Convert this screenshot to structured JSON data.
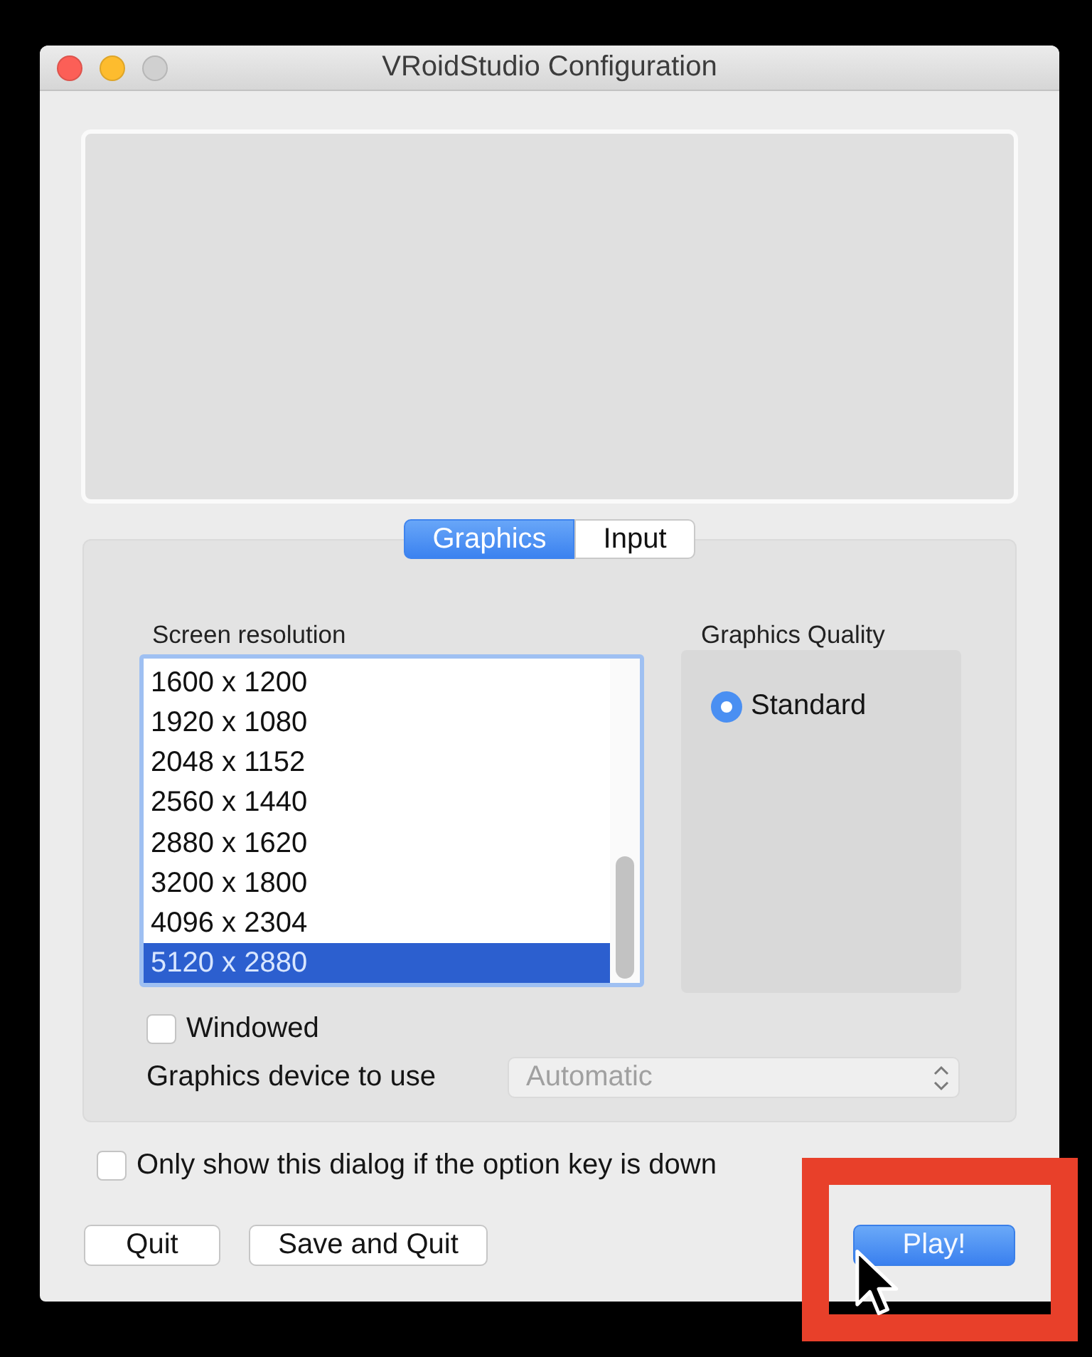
{
  "window": {
    "title": "VRoidStudio Configuration",
    "controls": [
      {
        "kind": "close",
        "disabled": false
      },
      {
        "kind": "minimize",
        "disabled": false
      },
      {
        "kind": "zoom",
        "disabled": true
      }
    ]
  },
  "tabs": [
    {
      "label": "Graphics",
      "selected": true
    },
    {
      "label": "Input",
      "selected": false
    }
  ],
  "screen_resolution": {
    "label": "Screen resolution",
    "items": [
      {
        "label": "1600 x 1200",
        "selected": false
      },
      {
        "label": "1920 x 1080",
        "selected": false
      },
      {
        "label": "2048 x 1152",
        "selected": false
      },
      {
        "label": "2560 x 1440",
        "selected": false
      },
      {
        "label": "2880 x 1620",
        "selected": false
      },
      {
        "label": "3200 x 1800",
        "selected": false
      },
      {
        "label": "4096 x 2304",
        "selected": false
      },
      {
        "label": "5120 x 2880",
        "selected": true
      }
    ]
  },
  "graphics_quality": {
    "label": "Graphics Quality",
    "options": [
      {
        "label": "Standard",
        "selected": true
      }
    ]
  },
  "windowed": {
    "label": "Windowed",
    "checked": false
  },
  "graphics_device": {
    "label": "Graphics device to use",
    "value": "Automatic",
    "disabled": true
  },
  "option_key_only": {
    "label": "Only show this dialog if the option key is down",
    "checked": false
  },
  "buttons": [
    {
      "label": "Quit",
      "kind": "default"
    },
    {
      "label": "Save and Quit",
      "kind": "default"
    },
    {
      "label": "Play!",
      "kind": "primary"
    }
  ]
}
